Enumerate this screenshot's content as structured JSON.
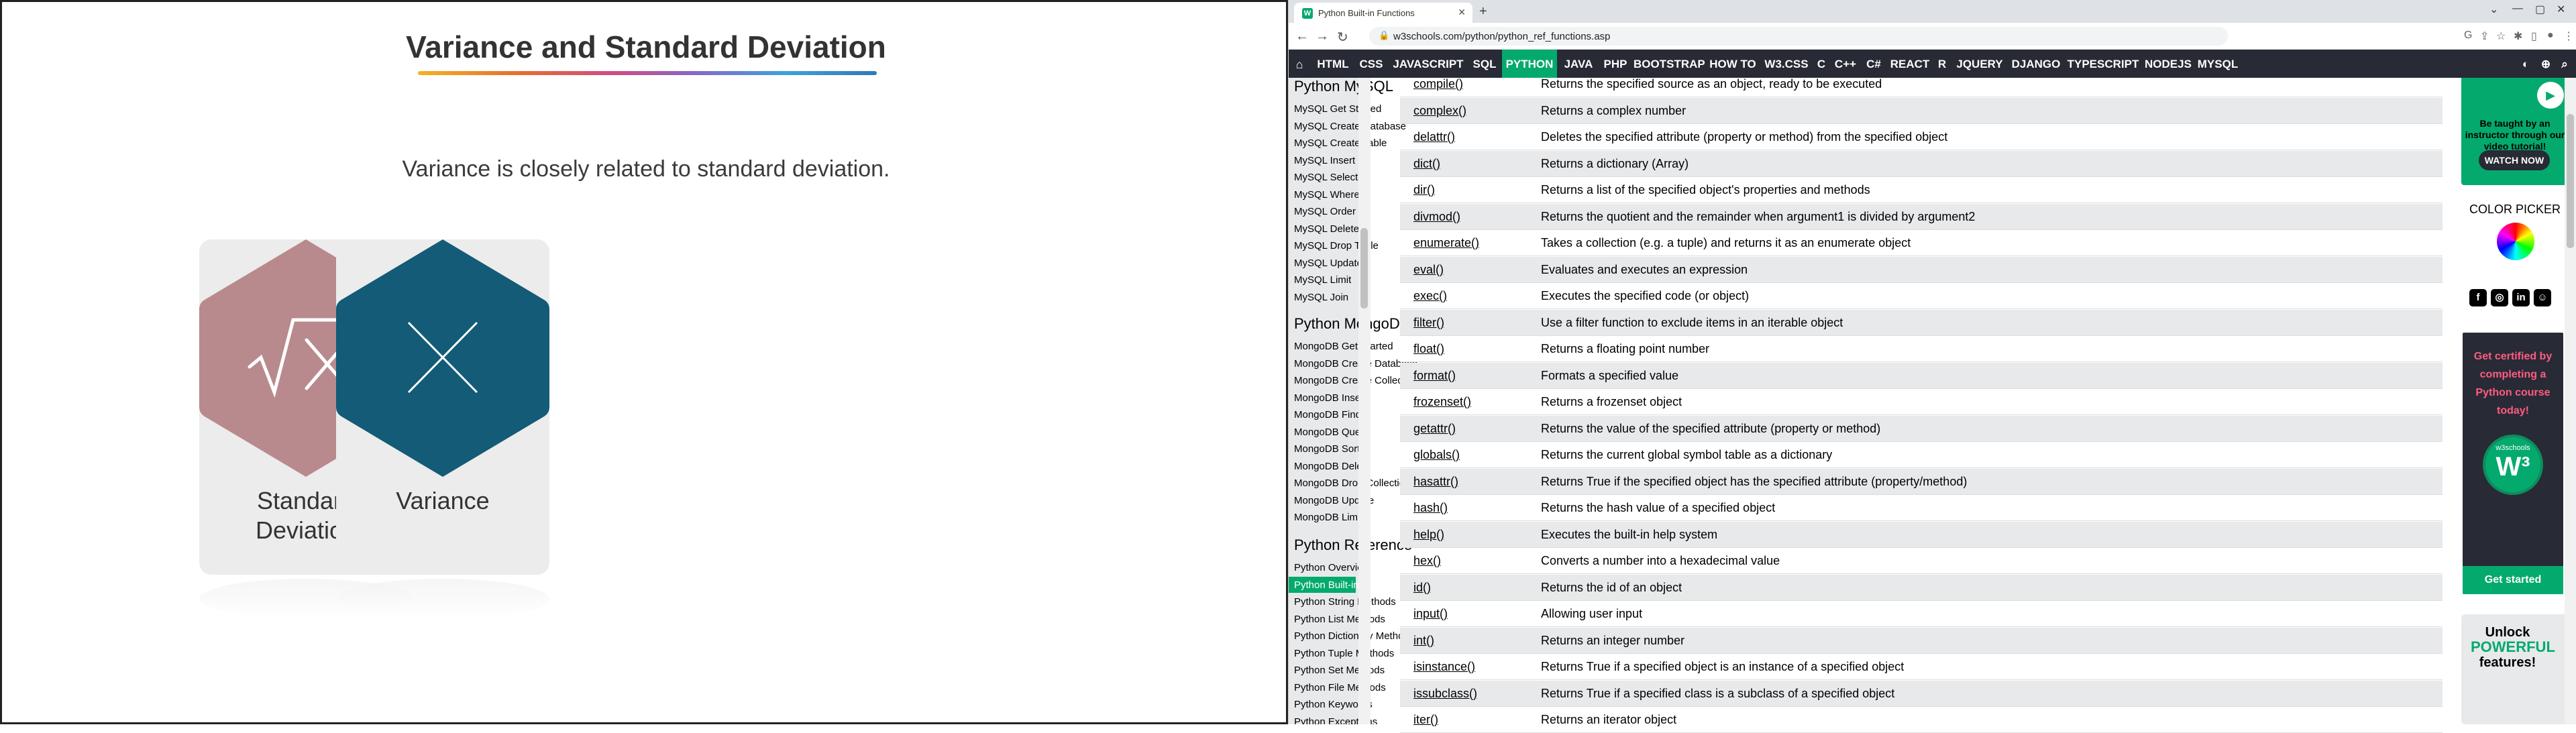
{
  "slide": {
    "title": "Variance and Standard Deviation",
    "subtitle": "Variance is closely related to standard deviation.",
    "cards": [
      {
        "label": "Standard Deviation",
        "icon": "square-root-x-icon",
        "color": "#b98a8d"
      },
      {
        "label": "Variance",
        "icon": "x-icon",
        "color": "#135b76"
      }
    ]
  },
  "browser": {
    "tab_title": "Python Built-in Functions",
    "favicon": "W",
    "url": "w3schools.com/python/python_ref_functions.asp"
  },
  "topnav": {
    "items": [
      "HTML",
      "CSS",
      "JAVASCRIPT",
      "SQL",
      "PYTHON",
      "JAVA",
      "PHP",
      "BOOTSTRAP",
      "HOW TO",
      "W3.CSS",
      "C",
      "C++",
      "C#",
      "REACT",
      "R",
      "JQUERY",
      "DJANGO",
      "TYPESCRIPT",
      "NODEJS",
      "MYSQL"
    ],
    "active": "PYTHON"
  },
  "sidebar": {
    "mysql_heading": "Python MySQL",
    "mysql_items": [
      "MySQL Get Started",
      "MySQL Create Database",
      "MySQL Create Table",
      "MySQL Insert",
      "MySQL Select",
      "MySQL Where",
      "MySQL Order By",
      "MySQL Delete",
      "MySQL Drop Table",
      "MySQL Update",
      "MySQL Limit",
      "MySQL Join"
    ],
    "mongo_heading": "Python MongoDB",
    "mongo_items": [
      "MongoDB Get Started",
      "MongoDB Create Database",
      "MongoDB Create Collection",
      "MongoDB Insert",
      "MongoDB Find",
      "MongoDB Query",
      "MongoDB Sort",
      "MongoDB Delete",
      "MongoDB Drop Collection",
      "MongoDB Update",
      "MongoDB Limit"
    ],
    "ref_heading": "Python Reference",
    "ref_items": [
      "Python Overview",
      "Python Built-in Functions",
      "Python String Methods",
      "Python List Methods",
      "Python Dictionary Methods",
      "Python Tuple Methods",
      "Python Set Methods",
      "Python File Methods",
      "Python Keywords",
      "Python Exceptions"
    ],
    "active_item": "Python Built-in Functions"
  },
  "functions": [
    {
      "name": "compile()",
      "desc": "Returns the specified source as an object, ready to be executed"
    },
    {
      "name": "complex()",
      "desc": "Returns a complex number"
    },
    {
      "name": "delattr()",
      "desc": "Deletes the specified attribute (property or method) from the specified object"
    },
    {
      "name": "dict()",
      "desc": "Returns a dictionary (Array)"
    },
    {
      "name": "dir()",
      "desc": "Returns a list of the specified object's properties and methods"
    },
    {
      "name": "divmod()",
      "desc": "Returns the quotient and the remainder when argument1 is divided by argument2"
    },
    {
      "name": "enumerate()",
      "desc": "Takes a collection (e.g. a tuple) and returns it as an enumerate object"
    },
    {
      "name": "eval()",
      "desc": "Evaluates and executes an expression"
    },
    {
      "name": "exec()",
      "desc": "Executes the specified code (or object)"
    },
    {
      "name": "filter()",
      "desc": "Use a filter function to exclude items in an iterable object"
    },
    {
      "name": "float()",
      "desc": "Returns a floating point number"
    },
    {
      "name": "format()",
      "desc": "Formats a specified value"
    },
    {
      "name": "frozenset()",
      "desc": "Returns a frozenset object"
    },
    {
      "name": "getattr()",
      "desc": "Returns the value of the specified attribute (property or method)"
    },
    {
      "name": "globals()",
      "desc": "Returns the current global symbol table as a dictionary"
    },
    {
      "name": "hasattr()",
      "desc": "Returns True if the specified object has the specified attribute (property/method)"
    },
    {
      "name": "hash()",
      "desc": "Returns the hash value of a specified object"
    },
    {
      "name": "help()",
      "desc": "Executes the built-in help system"
    },
    {
      "name": "hex()",
      "desc": "Converts a number into a hexadecimal value"
    },
    {
      "name": "id()",
      "desc": "Returns the id of an object"
    },
    {
      "name": "input()",
      "desc": "Allowing user input"
    },
    {
      "name": "int()",
      "desc": "Returns an integer number"
    },
    {
      "name": "isinstance()",
      "desc": "Returns True if a specified object is an instance of a specified object"
    },
    {
      "name": "issubclass()",
      "desc": "Returns True if a specified class is a subclass of a specified object"
    },
    {
      "name": "iter()",
      "desc": "Returns an iterator object"
    }
  ],
  "ads": {
    "video_text": "Be taught by an instructor through our video tutorial!",
    "watch_now": "WATCH NOW",
    "color_picker": "COLOR PICKER",
    "cert_text": "Get certified by completing a Python course today!",
    "cert_badge": "w3schools",
    "get_started": "Get started",
    "unlock_1": "Unlock",
    "unlock_2": "POWERFUL",
    "unlock_3": "features!"
  },
  "colors": {
    "w3_green": "#04aa6d",
    "nav_dark": "#282a35",
    "sidebar_bg": "#e7e9eb"
  }
}
